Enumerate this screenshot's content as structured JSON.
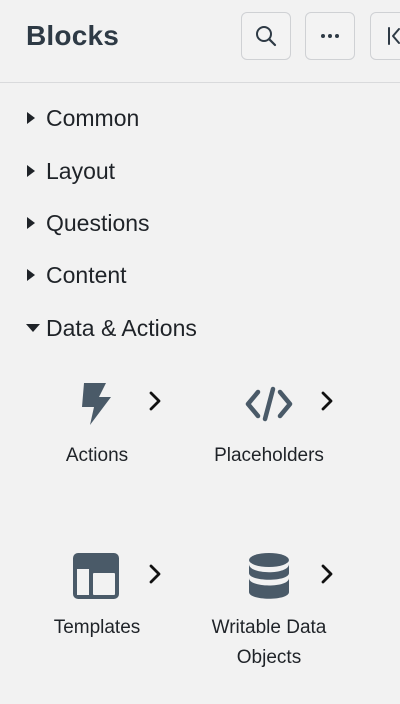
{
  "header": {
    "title": "Blocks",
    "buttons": {
      "search_icon": "search-icon",
      "more_icon": "more-horizontal-icon",
      "collapse_icon": "collapse-left-icon"
    }
  },
  "sections": [
    {
      "label": "Common",
      "expanded": false
    },
    {
      "label": "Layout",
      "expanded": false
    },
    {
      "label": "Questions",
      "expanded": false
    },
    {
      "label": "Content",
      "expanded": false
    },
    {
      "label": "Data & Actions",
      "expanded": true
    }
  ],
  "tiles": [
    {
      "label": "Actions",
      "icon": "lightning-icon"
    },
    {
      "label": "Placeholders",
      "icon": "code-icon"
    },
    {
      "label": "Templates",
      "icon": "template-icon"
    },
    {
      "label": "Writable Data Objects",
      "icon": "database-icon"
    }
  ],
  "colors": {
    "background": "#f2f2f2",
    "icon": "#4a5a68",
    "text": "#1f2328",
    "title": "#2e3a45",
    "border": "#cfd1d4"
  }
}
